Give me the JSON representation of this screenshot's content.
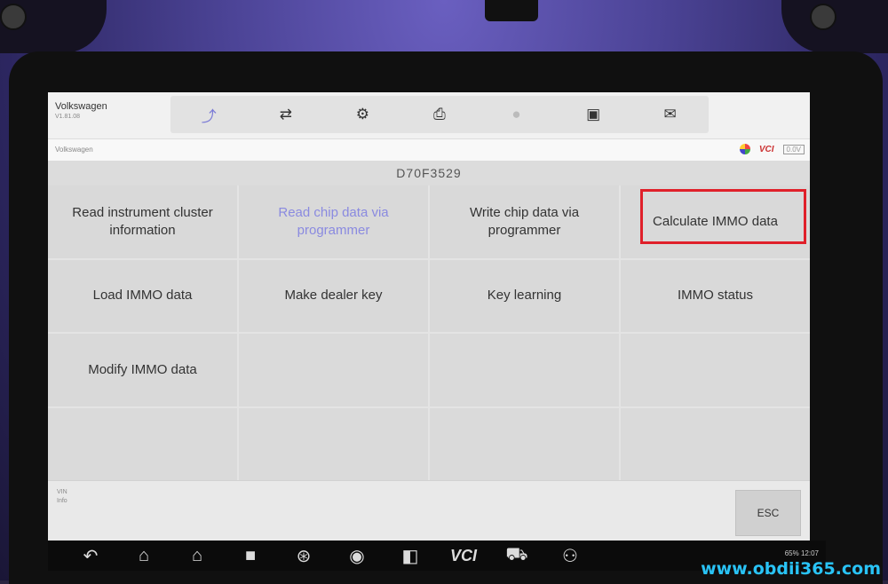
{
  "app": {
    "brand": "Volkswagen",
    "version": "V1.81.08",
    "breadcrumb": "Volkswagen",
    "module_title": "D70F3529"
  },
  "toolbar": [
    {
      "icon": "car-home-icon",
      "glyph": "⤴",
      "state": "active"
    },
    {
      "icon": "connector-icon",
      "glyph": "⇄",
      "state": "normal"
    },
    {
      "icon": "gear-icon",
      "glyph": "⚙",
      "state": "normal"
    },
    {
      "icon": "printer-icon",
      "glyph": "⎙",
      "state": "normal"
    },
    {
      "icon": "help-icon",
      "glyph": "●",
      "state": "disabled"
    },
    {
      "icon": "save-icon",
      "glyph": "▣",
      "state": "normal"
    },
    {
      "icon": "message-icon",
      "glyph": "✉",
      "state": "normal"
    }
  ],
  "status": {
    "vci_label": "VCI",
    "battery_text": "0.0V"
  },
  "functions": [
    {
      "label": "Read instrument cluster information",
      "state": "normal"
    },
    {
      "label": "Read chip data via programmer",
      "state": "highlight"
    },
    {
      "label": "Write chip data via programmer",
      "state": "normal"
    },
    {
      "label": "Calculate IMMO data",
      "state": "selected"
    },
    {
      "label": "Load IMMO data",
      "state": "normal"
    },
    {
      "label": "Make dealer key",
      "state": "normal"
    },
    {
      "label": "Key learning",
      "state": "normal"
    },
    {
      "label": "IMMO status",
      "state": "normal"
    },
    {
      "label": "Modify IMMO data",
      "state": "normal"
    }
  ],
  "info": {
    "vin_label": "VIN",
    "info_label": "Info"
  },
  "esc_label": "ESC",
  "navbar": [
    {
      "icon": "back-icon",
      "glyph": "↶"
    },
    {
      "icon": "home-icon",
      "glyph": "⌂"
    },
    {
      "icon": "desktop-icon",
      "glyph": "⌂"
    },
    {
      "icon": "recent-apps-icon",
      "glyph": "■"
    },
    {
      "icon": "browser-icon",
      "glyph": "⊛"
    },
    {
      "icon": "camera-icon",
      "glyph": "◉"
    },
    {
      "icon": "screen-record-icon",
      "glyph": "◧"
    },
    {
      "icon": "vci-icon",
      "glyph": "VCI"
    },
    {
      "icon": "car-icon",
      "glyph": "⛟"
    },
    {
      "icon": "remote-support-icon",
      "glyph": "⚇"
    }
  ],
  "system_status": "65% 12:07",
  "watermark": "www.obdii365.com",
  "colors": {
    "accent": "#7b7bd6",
    "selection_border": "#e0202a",
    "watermark": "#29c3f6"
  }
}
